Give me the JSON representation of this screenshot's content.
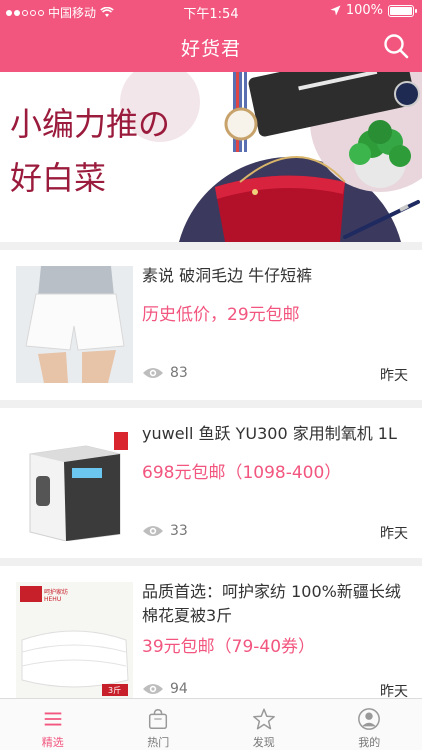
{
  "status_bar": {
    "carrier": "中国移动",
    "time": "下午1:54",
    "battery": "100%"
  },
  "nav": {
    "title": "好货君"
  },
  "banner": {
    "line1": "小编力推の",
    "line2": "好白菜"
  },
  "items": [
    {
      "title": "素说 破洞毛边 牛仔短裤",
      "price": "历史低价，29元包邮",
      "views": "83",
      "date": "昨天"
    },
    {
      "title": "yuwell 鱼跃 YU300 家用制氧机 1L",
      "price": "698元包邮（1098-400）",
      "views": "33",
      "date": "昨天"
    },
    {
      "title": "品质首选：呵护家纺 100%新疆长绒棉花夏被3斤",
      "price": "39元包邮（79-40券）",
      "views": "94",
      "date": "昨天",
      "brand_text": "呵护家纺",
      "brand_text_en": "HEHU",
      "weight_tag": "3斤"
    }
  ],
  "tabs": [
    {
      "label": "精选",
      "icon": "menu-icon",
      "active": true
    },
    {
      "label": "热门",
      "icon": "bag-icon",
      "active": false
    },
    {
      "label": "发现",
      "icon": "star-icon",
      "active": false
    },
    {
      "label": "我的",
      "icon": "user-icon",
      "active": false
    }
  ],
  "colors": {
    "accent": "#f2567f",
    "banner_text": "#9b1b3c"
  }
}
